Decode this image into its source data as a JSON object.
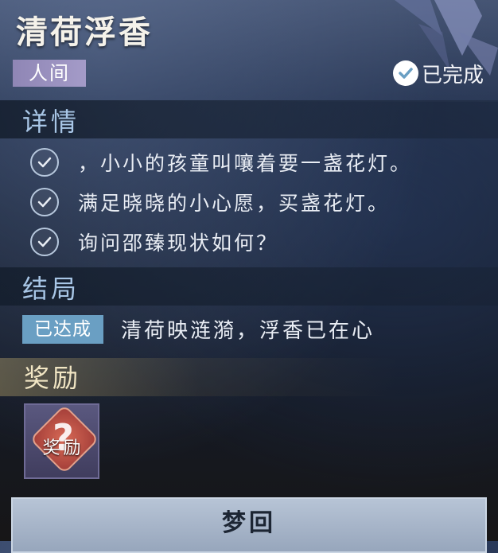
{
  "quest": {
    "title": "清荷浮香",
    "realm": "人间",
    "status": "已完成"
  },
  "details": {
    "heading": "详情",
    "goals": [
      {
        "text": "，小小的孩童叫嚷着要一盏花灯。",
        "completed": true
      },
      {
        "text": "满足晓晓的小心愿，买盏花灯。",
        "completed": true
      },
      {
        "text": "询问邵臻现状如何？",
        "completed": true
      }
    ]
  },
  "ending": {
    "heading": "结局",
    "badge": "已达成",
    "text": "清荷映涟漪，浮香已在心"
  },
  "reward": {
    "heading": "奖励",
    "item_label": "奖励",
    "item_mark": "?"
  },
  "actions": {
    "dream_button": "梦回"
  },
  "colors": {
    "realm_tag": "#a49bc8",
    "ending_badge": "#6a9fc3",
    "section_label": "#a8c6e6",
    "reward_label": "#f1e6c4"
  }
}
